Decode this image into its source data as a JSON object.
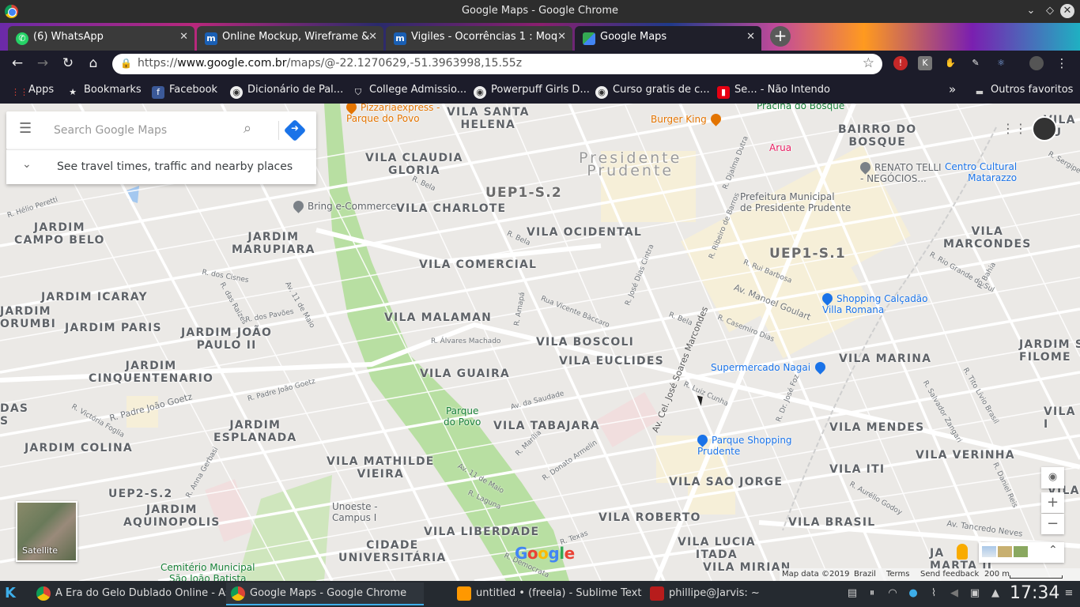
{
  "window": {
    "title": "Google Maps - Google Chrome"
  },
  "tabs": [
    {
      "label": "(6) WhatsApp",
      "icon": "whatsapp-icon"
    },
    {
      "label": "Online Mockup, Wireframe &",
      "icon": "moqups-icon"
    },
    {
      "label": "Vigiles - Ocorrências 1 : Moq",
      "icon": "moqups-icon"
    },
    {
      "label": "Google Maps",
      "icon": "google-maps-icon",
      "active": true
    }
  ],
  "omnibox": {
    "url": "https://www.google.com.br/maps/@-22.1270629,-51.3963998,15.55z",
    "host_part": "www.google.com.br",
    "scheme": "https://",
    "path_part": "/maps/@-22.1270629,-51.3963998,15.55z"
  },
  "bookmarks": [
    "Apps",
    "Bookmarks",
    "Facebook",
    "Dicionário de Pal...",
    "College Admissio...",
    "Powerpuff Girls D...",
    "Curso gratis de c...",
    "Se... - Não Intendo"
  ],
  "bookmarks_other": "Outros favoritos",
  "search": {
    "placeholder": "Search Google Maps",
    "travel": "See travel times, traffic and nearby places"
  },
  "map": {
    "areas": [
      {
        "t": "VILA SANTA\nHELENA"
      },
      {
        "t": "BAIRRO DO\nBOSQUE"
      },
      {
        "t": "VILA CLAUDIA\nGLORIA"
      },
      {
        "t": "UEP1-S.2"
      },
      {
        "t": "VILA CHARLOTE"
      },
      {
        "t": "JARDIM\nCAMPO BELO"
      },
      {
        "t": "JARDIM\nMARUPIARA"
      },
      {
        "t": "VILA OCIDENTAL"
      },
      {
        "t": "UEP1-S.1"
      },
      {
        "t": "VILA\nMARCONDES"
      },
      {
        "t": "VILA COMERCIAL"
      },
      {
        "t": "JARDIM ICARAY"
      },
      {
        "t": "JARDIM PARIS"
      },
      {
        "t": "JARDIM JOÃO\nPAULO II"
      },
      {
        "t": "VILA MALAMAN"
      },
      {
        "t": "VILA BOSCOLI"
      },
      {
        "t": "VILA EUCLIDES"
      },
      {
        "t": "VILA MARINA"
      },
      {
        "t": "JARDIM\nCINQUENTENARIO"
      },
      {
        "t": "VILA GUAIRA"
      },
      {
        "t": "JARDIM\nESPLANADA"
      },
      {
        "t": "VILA TABAJARA"
      },
      {
        "t": "VILA MENDES"
      },
      {
        "t": "VILA VERINHA"
      },
      {
        "t": "JARDIM COLINA"
      },
      {
        "t": "VILA MATHILDE\nVIEIRA"
      },
      {
        "t": "VILA ITI"
      },
      {
        "t": "UEP2-S.2"
      },
      {
        "t": "JARDIM\nAQUINOPOLIS"
      },
      {
        "t": "VILA SAO JORGE"
      },
      {
        "t": "VILA ROBERTO"
      },
      {
        "t": "VILA BRASIL"
      },
      {
        "t": "VILA LIBERDADE"
      },
      {
        "t": "CIDADE\nUNIVERSITÁRIA"
      },
      {
        "t": "VILA LUCIA\nITADA"
      },
      {
        "t": "VILA MIRIAN"
      },
      {
        "t": "JARDIM S\nFILOME"
      },
      {
        "t": "JARDIM\nORUMBI"
      },
      {
        "t": "DAS\nS"
      },
      {
        "t": "VILA FU"
      },
      {
        "t": "VILA I"
      },
      {
        "t": "VILA\nCE"
      },
      {
        "t": "JA\nMARTA II"
      }
    ],
    "city": "Presidente\nPrudente",
    "pois": [
      {
        "t": "Pizzariaexpress -\nParque do Povo",
        "c": "#e37400"
      },
      {
        "t": "Burger King",
        "c": "#e37400"
      },
      {
        "t": "Arua",
        "c": "#e91e63"
      },
      {
        "t": "Praciña do Bosque",
        "c": "#188038"
      },
      {
        "t": "Bring e-Commerce",
        "c": "#5f6368"
      },
      {
        "t": "Prefeitura Municipal\nde Presidente Prudente",
        "c": "#5f6368"
      },
      {
        "t": "RENATO TELLI\n- NEGÓCIOS...",
        "c": "#5f6368"
      },
      {
        "t": "Centro Cultural\nMatarazzo",
        "c": "#1a73e8"
      },
      {
        "t": "Shopping Calçadão\nVilla Romana",
        "c": "#1a73e8"
      },
      {
        "t": "Supermercado Nagai",
        "c": "#1a73e8"
      },
      {
        "t": "Parque Shopping\nPrudente",
        "c": "#1a73e8"
      },
      {
        "t": "Parque\ndo Povo",
        "c": "#188038"
      },
      {
        "t": "Unoeste -\nCampus I",
        "c": "#5f6368"
      },
      {
        "t": "Cemitério Municipal\nSão João Batista",
        "c": "#188038"
      }
    ],
    "streets": [
      "R. Hélio Peretti",
      "R. Bela",
      "R. Bela",
      "R. José Dias Cintra",
      "R. Djalma Dutra",
      "R. Ribeiro de Barros",
      "Av. Manoel Goulart",
      "R. Rui Barbosa",
      "R. Casemiro Dias",
      "Av. Cel. José Soares Marcondes",
      "R. Luiz Cunha",
      "R. Dr. José Foz",
      "Rua Vicente Bàccaro",
      "R. Amapá",
      "R. Álvares Machado",
      "Av. 11 de Maio",
      "R. dos Cisnes",
      "R. das Raizes",
      "R. dos Pavões",
      "R. Padre João Goetz",
      "R. Padre João Goetz",
      "R. Victória Foglia",
      "Av. da Saudade",
      "R. Marília",
      "R. Donato Armelin",
      "Av. 11 de Maio",
      "R. Laguna",
      "R. Texas",
      "R. Democrata",
      "Av. Tancredo Neves",
      "R. Salvador Zangari",
      "R. Tito Lívio Brasil",
      "R. Aurélio Godoy",
      "R. Daniel Reis",
      "R. Rio Grande do Sul",
      "R. Bahia",
      "R. Sergipe",
      "R. Anna Gerbasi",
      "R. Bela"
    ],
    "satellite": "Satellite",
    "attribution": {
      "data": "Map data ©2019",
      "country": "Brazil",
      "terms": "Terms",
      "feedback": "Send feedback",
      "scale": "200 m"
    }
  },
  "taskbar": {
    "tasks": [
      "A Era do Gelo Dublado Online - As...",
      "Google Maps - Google Chrome",
      "untitled • (freela) - Sublime Text (...",
      "phillipe@Jarvis: ~"
    ],
    "clock": "17:34"
  }
}
